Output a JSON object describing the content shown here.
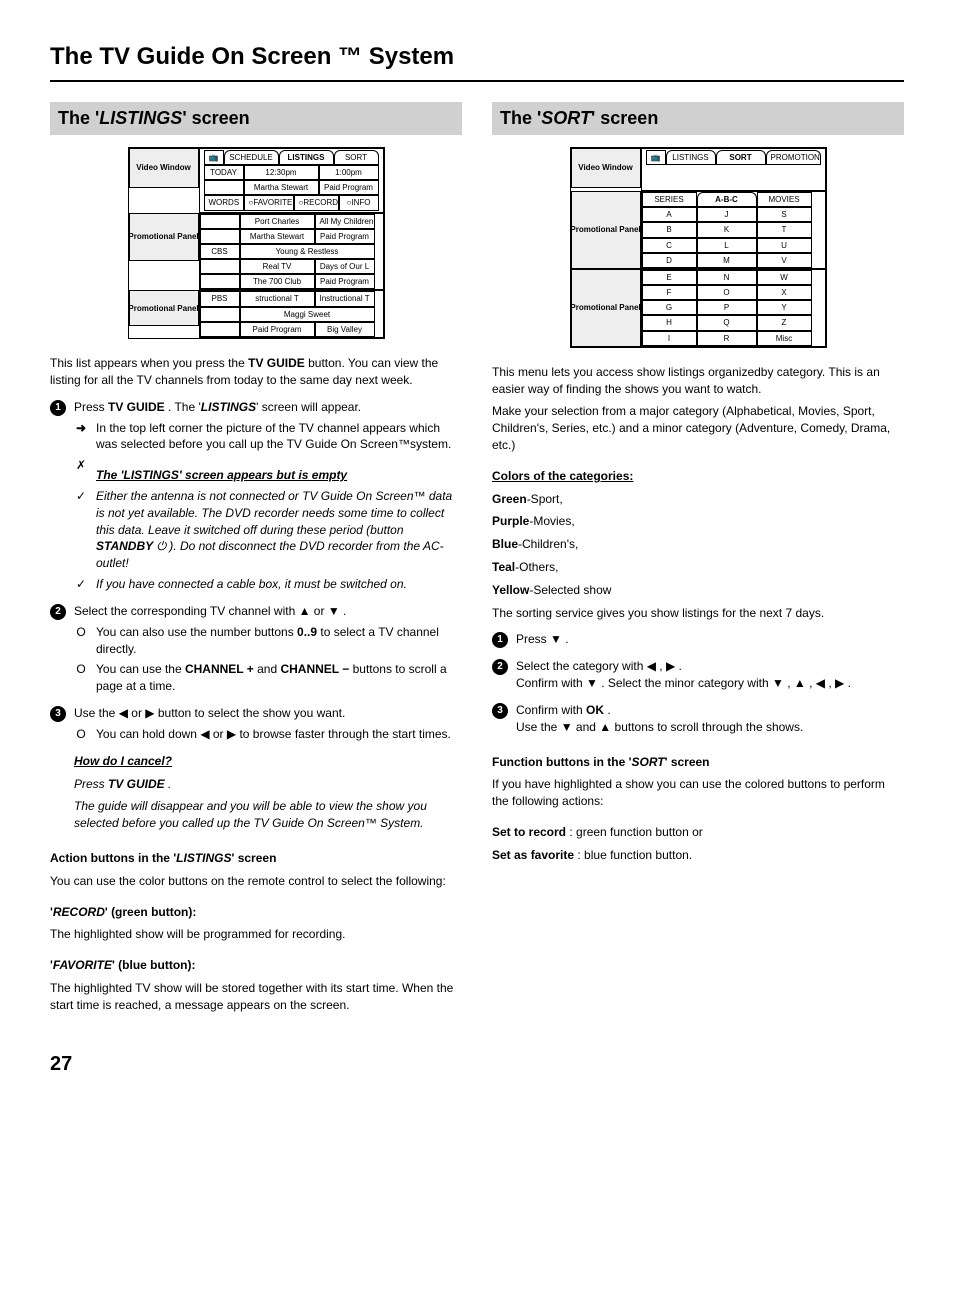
{
  "page": {
    "title": "The TV Guide On Screen ™ System",
    "number": "27"
  },
  "left": {
    "section_title_pre": "The '",
    "section_title_ital": "LISTINGS",
    "section_title_post": "' screen",
    "figure": {
      "panels": [
        "Video Window",
        "Promotional Panel",
        "Promotional Panel"
      ],
      "tabs": [
        "SCHEDULE",
        "LISTINGS",
        "SORT"
      ],
      "header": [
        "TODAY",
        "12:30pm",
        "1:00pm"
      ],
      "rows": [
        [
          "",
          "Martha Stewart",
          "Paid Program"
        ],
        [
          "",
          "Port Charles",
          "All My Children"
        ],
        [
          "",
          "Martha Stewart",
          "Paid Program"
        ],
        [
          "CBS",
          "Young & Restless",
          ""
        ],
        [
          "",
          "Real TV",
          "Days of Our L"
        ],
        [
          "",
          "The 700 Club",
          "Paid Program"
        ],
        [
          "PBS",
          "structional T",
          "Instructional T"
        ],
        [
          "",
          "Maggi Sweet",
          ""
        ],
        [
          "",
          "Paid Program",
          "Big Valley"
        ]
      ],
      "infobar": [
        "FAVORITES",
        "RECORD",
        "INFO"
      ],
      "words": "WORDS"
    },
    "intro": "This list appears when you press the ",
    "intro_btn": "TV GUIDE",
    "intro_post": " button. You can view the listing for all the TV channels from today to the same day next week.",
    "step1a": "Press ",
    "step1b": "TV GUIDE",
    "step1c": " . The '",
    "step1d": "LISTINGS",
    "step1e": "' screen will appear.",
    "step1_sub": "In the top left corner the picture of the TV channel appears which was selected before you call up the TV Guide On Screen™system.",
    "empty_title": "The 'LISTINGS' screen appears but is empty",
    "empty_note1a": "Either the antenna is not connected or TV Guide On Screen™ data is not yet available. The DVD recorder needs some time to collect this data. Leave it switched off during these period (button ",
    "empty_note1b": "STANDBY",
    "empty_note1c": " ⏻ ). Do not disconnect the DVD recorder from the AC-outlet!",
    "empty_note2": "If you have connected a cable box, it must be switched on.",
    "step2a": "Select the corresponding TV channel with ",
    "step2b": " or ",
    "step2c": " .",
    "step2_sub1a": "You can also use the number buttons ",
    "step2_sub1b": "0..9",
    "step2_sub1c": " to select a TV channel directly.",
    "step2_sub2a": "You can use the ",
    "step2_sub2b": "CHANNEL +",
    "step2_sub2c": " and ",
    "step2_sub2d": "CHANNEL −",
    "step2_sub2e": " buttons to scroll a page at a time.",
    "step3a": "Use the ",
    "step3b": " or ",
    "step3c": " button to select the show you want.",
    "step3_sub1a": "You can hold down ",
    "step3_sub1b": " or ",
    "step3_sub1c": " to browse faster through the start times.",
    "cancel_title": "How do I cancel?",
    "cancel_press": "Press ",
    "cancel_btn": "TV GUIDE",
    "cancel_post": " .",
    "cancel_body": "The guide will disappear and you will be able to view the show you selected before you called up the TV Guide On Screen™ System.",
    "action_heading_pre": "Action buttons in the '",
    "action_heading_ital": "LISTINGS",
    "action_heading_post": "' screen",
    "action_intro": "You can use the color buttons on the remote control to select the following:",
    "record_label_pre": "'",
    "record_label_ital": "RECORD",
    "record_label_post": "' (green button)",
    "record_body": "The highlighted show will be programmed for recording.",
    "fav_label_pre": "'",
    "fav_label_ital": "FAVORITE",
    "fav_label_post": "' (blue button)",
    "fav_body": "The highlighted TV show will be stored together with its start time. When the start time is reached, a message appears on the screen."
  },
  "right": {
    "section_title_pre": "The '",
    "section_title_ital": "SORT",
    "section_title_post": "' screen",
    "figure": {
      "panels": [
        "Video Window",
        "Promotional Panel",
        "Promotional Panel"
      ],
      "tabs": [
        "LISTINGS",
        "SORT",
        "PROMOTION"
      ],
      "header": [
        "SERIES",
        "A-B-C",
        "MOVIES"
      ],
      "cols": [
        [
          "A",
          "B",
          "C",
          "D",
          "E",
          "F",
          "G",
          "H",
          "I"
        ],
        [
          "J",
          "K",
          "L",
          "M",
          "N",
          "O",
          "P",
          "Q",
          "R"
        ],
        [
          "S",
          "T",
          "U",
          "V",
          "W",
          "X",
          "Y",
          "Z",
          "Misc"
        ]
      ]
    },
    "intro": "This menu lets you access show listings organizedby category. This is an easier way of finding the shows you want to watch.",
    "intro2": "Make your selection from a major category (Alphabetical, Movies, Sport, Children's, Series, etc.) and a minor category (Adventure, Comedy, Drama, etc.)",
    "colors_heading": "Colors of the categories:",
    "colors": [
      {
        "name": "Green",
        "desc": "-Sport,"
      },
      {
        "name": "Purple",
        "desc": "-Movies,"
      },
      {
        "name": "Blue",
        "desc": "-Children's,"
      },
      {
        "name": "Teal",
        "desc": "-Others,"
      },
      {
        "name": "Yellow",
        "desc": "-Selected show"
      }
    ],
    "colors_post": "The sorting service gives you show listings for the next 7 days.",
    "step1a": "Press ",
    "step1b": " .",
    "step2a": "Select the category with ",
    "step2b": " , ",
    "step2c": " .",
    "step2d": "Confirm with ",
    "step2e": " . Select the minor category with ",
    "step2f": " , ",
    "step2g": " , ",
    "step2h": " , ",
    "step2i": " .",
    "step3a": "Confirm with ",
    "step3b": "OK",
    "step3c": " .",
    "step3d": "Use the ",
    "step3e": " and ",
    "step3f": " buttons to scroll through the shows.",
    "func_heading_pre": "Function buttons in the '",
    "func_heading_ital": "SORT",
    "func_heading_post": "' screen",
    "func_intro": "If you have highlighted a show you can use the colored buttons to perform the following actions:",
    "func_rec": "Set to record",
    "func_rec_post": " : green function button or",
    "func_fav": "Set as favorite",
    "func_fav_post": " : blue function button."
  },
  "icons": {
    "up": "▲",
    "down": "▼",
    "left": "◀",
    "right": "▶",
    "arrow": "➜",
    "check": "✓",
    "x": "✗",
    "circle": "O",
    "power": "⏻"
  }
}
